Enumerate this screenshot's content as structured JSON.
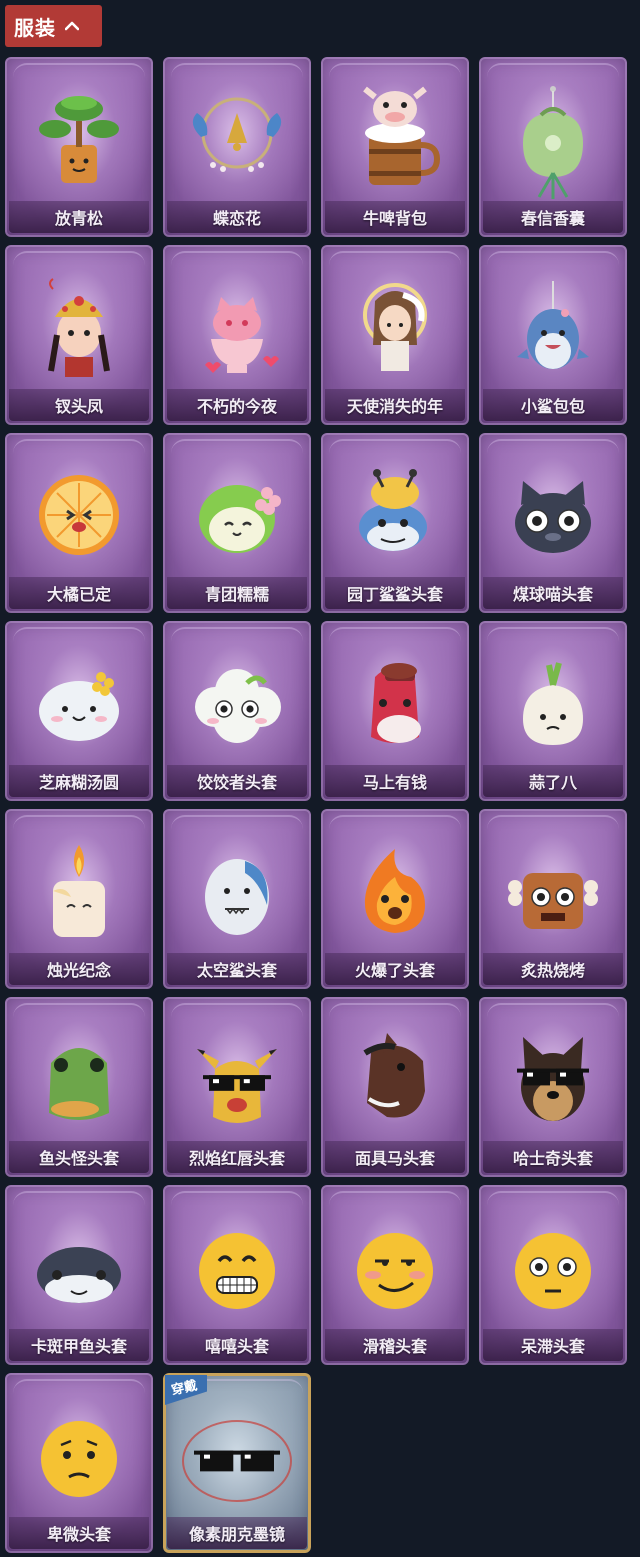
{
  "header": {
    "tab_label": "服装",
    "icon": "chevron-up-icon"
  },
  "items": [
    {
      "name": "放青松",
      "icon": "bonsai-pine-icon"
    },
    {
      "name": "蝶恋花",
      "icon": "butterfly-bell-ornament-icon"
    },
    {
      "name": "牛啤背包",
      "icon": "cow-beer-mug-icon"
    },
    {
      "name": "春信香囊",
      "icon": "green-sachet-icon"
    },
    {
      "name": "钗头凤",
      "icon": "phoenix-crown-girl-icon"
    },
    {
      "name": "不朽的今夜",
      "icon": "pink-cat-bowl-icon"
    },
    {
      "name": "天使消失的年",
      "icon": "angel-girl-halo-icon"
    },
    {
      "name": "小鲨包包",
      "icon": "shark-bag-icon"
    },
    {
      "name": "大橘已定",
      "icon": "orange-slice-face-icon"
    },
    {
      "name": "青团糯糯",
      "icon": "green-rice-ball-icon"
    },
    {
      "name": "园丁鲨鲨头套",
      "icon": "gardener-shark-head-icon"
    },
    {
      "name": "煤球喵头套",
      "icon": "black-cat-head-icon"
    },
    {
      "name": "芝麻糊汤圆",
      "icon": "rice-dumpling-icon"
    },
    {
      "name": "饺饺者头套",
      "icon": "dumpling-cloud-head-icon"
    },
    {
      "name": "马上有钱",
      "icon": "red-horse-head-icon"
    },
    {
      "name": "蒜了八",
      "icon": "garlic-head-icon"
    },
    {
      "name": "烛光纪念",
      "icon": "candle-head-icon"
    },
    {
      "name": "太空鲨头套",
      "icon": "space-shark-head-icon"
    },
    {
      "name": "火爆了头套",
      "icon": "fire-head-icon"
    },
    {
      "name": "炙热烧烤",
      "icon": "meat-bone-head-icon"
    },
    {
      "name": "鱼头怪头套",
      "icon": "fish-mask-head-icon"
    },
    {
      "name": "烈焰红唇头套",
      "icon": "yellow-mouse-sunglasses-icon"
    },
    {
      "name": "面具马头套",
      "icon": "horse-mask-head-icon"
    },
    {
      "name": "哈士奇头套",
      "icon": "husky-sunglasses-head-icon"
    },
    {
      "name": "卡斑甲鱼头套",
      "icon": "turtle-head-icon"
    },
    {
      "name": "嘻嘻头套",
      "icon": "grinning-emoji-head-icon"
    },
    {
      "name": "滑稽头套",
      "icon": "smirk-emoji-head-icon"
    },
    {
      "name": "呆滞头套",
      "icon": "dazed-emoji-head-icon"
    },
    {
      "name": "卑微头套",
      "icon": "humble-emoji-head-icon"
    },
    {
      "name": "像素朋克墨镜",
      "icon": "pixel-sunglasses-icon",
      "badge": "穿戴",
      "equipped": true
    }
  ]
}
